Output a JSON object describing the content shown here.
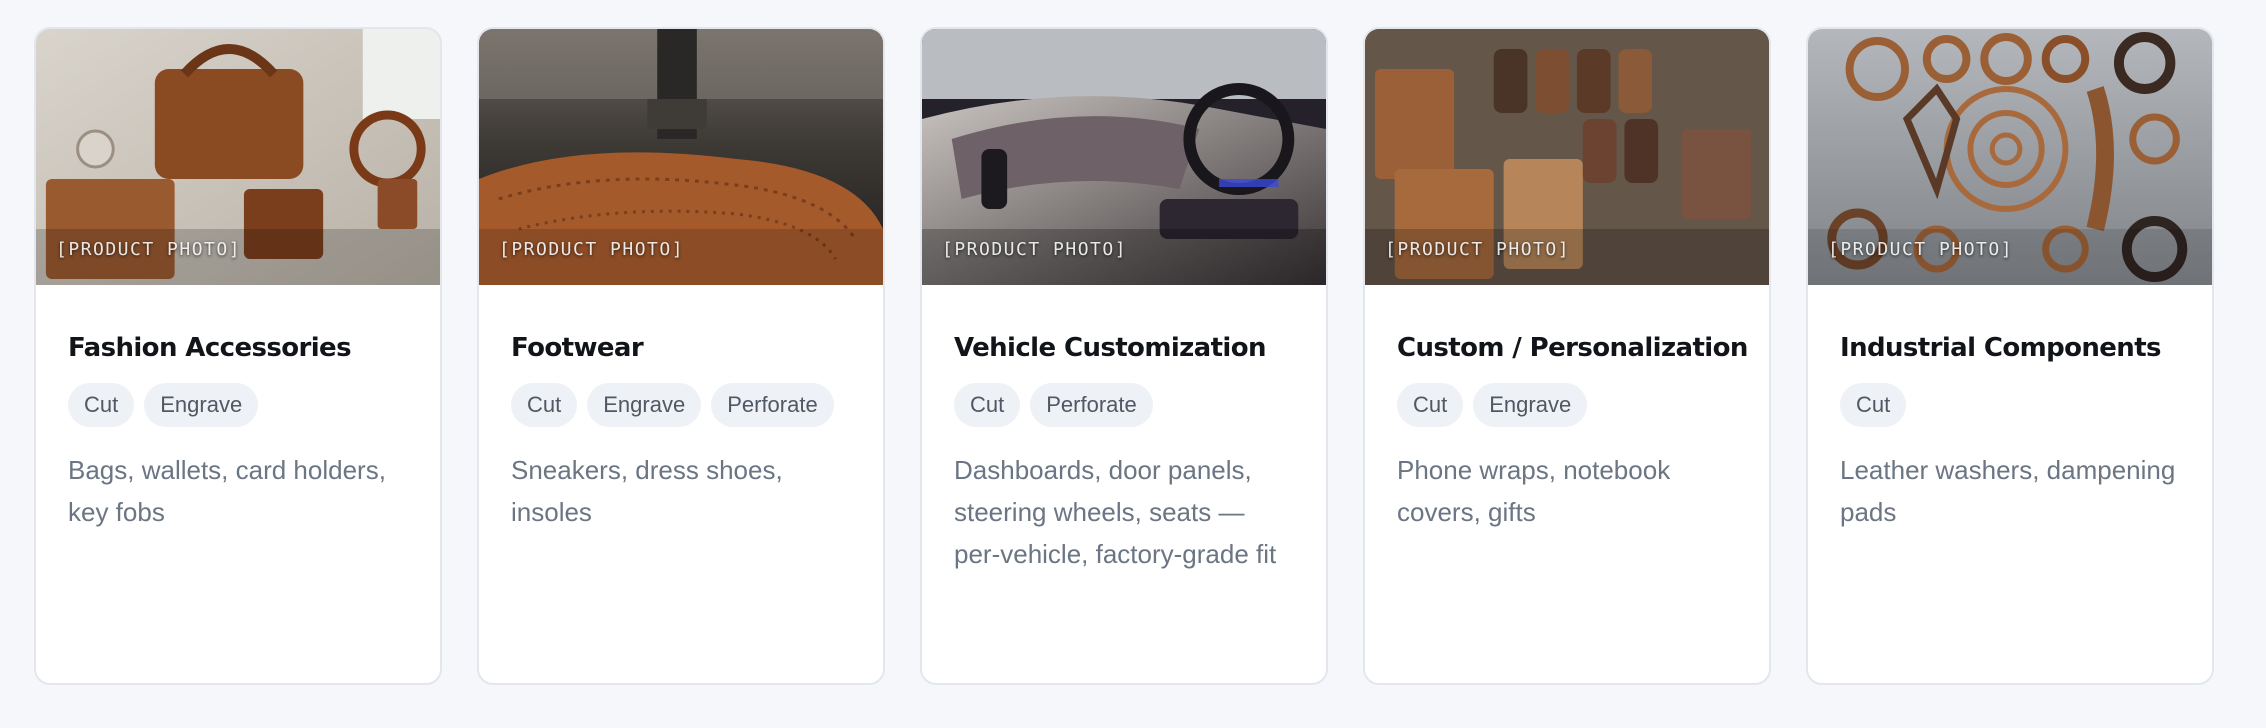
{
  "cards": [
    {
      "photo_label": "[PRODUCT PHOTO]",
      "title": "Fashion Accessories",
      "tags": [
        "Cut",
        "Engrave"
      ],
      "description": "Bags, wallets, card holders, key fobs"
    },
    {
      "photo_label": "[PRODUCT PHOTO]",
      "title": "Footwear",
      "tags": [
        "Cut",
        "Engrave",
        "Perforate"
      ],
      "description": "Sneakers, dress shoes, insoles"
    },
    {
      "photo_label": "[PRODUCT PHOTO]",
      "title": "Vehicle Customization",
      "tags": [
        "Cut",
        "Perforate"
      ],
      "description": "Dashboards, door panels, steering wheels, seats — per-vehicle, factory-grade fit"
    },
    {
      "photo_label": "[PRODUCT PHOTO]",
      "title": "Custom / Personalization",
      "tags": [
        "Cut",
        "Engrave"
      ],
      "description": "Phone wraps, notebook covers, gifts"
    },
    {
      "photo_label": "[PRODUCT PHOTO]",
      "title": "Industrial Components",
      "tags": [
        "Cut"
      ],
      "description": "Leather washers, dampening pads"
    }
  ],
  "colors": {
    "page_background": "#f5f7fa",
    "card_background": "#ffffff",
    "card_border": "#e3e7ed",
    "tag_background": "#eef1f5",
    "tag_text": "#4f5864",
    "title_text": "#111418",
    "description_text": "#6b7583"
  }
}
